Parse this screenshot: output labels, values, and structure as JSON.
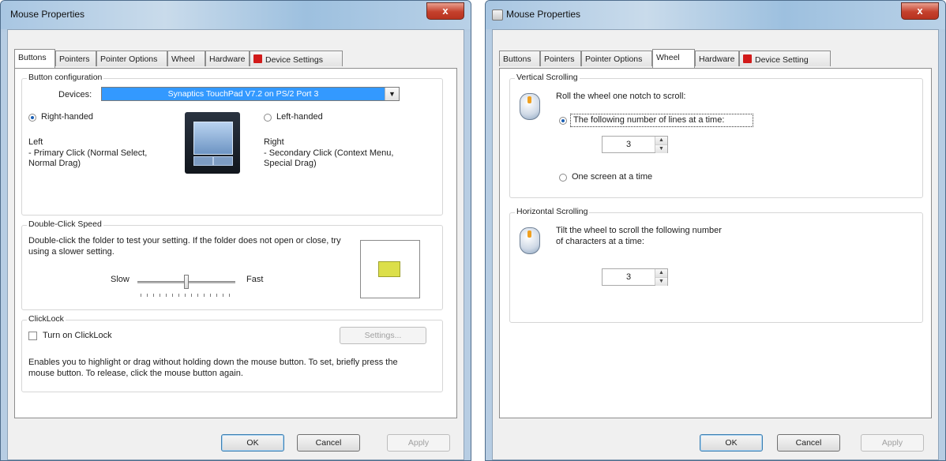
{
  "windows": [
    {
      "title": "Mouse Properties",
      "close_label": "x",
      "tabs": [
        "Buttons",
        "Pointers",
        "Pointer Options",
        "Wheel",
        "Hardware",
        "Device Settings"
      ],
      "active_tab": "Buttons",
      "button_configuration": {
        "group_label": "Button configuration",
        "devices_label": "Devices:",
        "device_value": "Synaptics TouchPad V7.2 on PS/2 Port 3",
        "right_handed": "Right-handed",
        "left_handed": "Left-handed",
        "selected": "Right-handed",
        "left_desc_title": "Left",
        "left_desc": "- Primary Click (Normal Select, Normal Drag)",
        "right_desc_title": "Right",
        "right_desc": "- Secondary Click (Context Menu, Special Drag)"
      },
      "double_click": {
        "group_label": "Double-Click Speed",
        "description": "Double-click the folder to test your setting.  If the folder does not open or close, try using a slower setting.",
        "slow_label": "Slow",
        "fast_label": "Fast",
        "level": 0.5
      },
      "clicklock": {
        "group_label": "ClickLock",
        "checkbox_label": "Turn on ClickLock",
        "checked": false,
        "settings_label": "Settings...",
        "description": "Enables you to highlight or drag without holding down the mouse button.  To set, briefly press the mouse button.  To release, click the mouse button again."
      },
      "footer": {
        "ok": "OK",
        "cancel": "Cancel",
        "apply": "Apply"
      }
    },
    {
      "title": "Mouse Properties",
      "close_label": "x",
      "tabs": [
        "Buttons",
        "Pointers",
        "Pointer Options",
        "Wheel",
        "Hardware",
        "Device Setting"
      ],
      "active_tab": "Wheel",
      "vertical": {
        "group_label": "Vertical Scrolling",
        "instruction": "Roll the wheel one notch to scroll:",
        "option_lines": "The following number of lines at a time:",
        "lines_value": "3",
        "option_screen": "One screen at a time",
        "selected": "lines"
      },
      "horizontal": {
        "group_label": "Horizontal Scrolling",
        "instruction_line1": "Tilt the wheel to scroll the following number",
        "instruction_line2": "of characters at a time:",
        "chars_value": "3"
      },
      "footer": {
        "ok": "OK",
        "cancel": "Cancel",
        "apply": "Apply"
      }
    }
  ],
  "colors": {
    "selection": "#3399ff",
    "title_bar": "#b7cde3",
    "close_button": "#c4402c",
    "device_icon": "#d21a1a"
  }
}
